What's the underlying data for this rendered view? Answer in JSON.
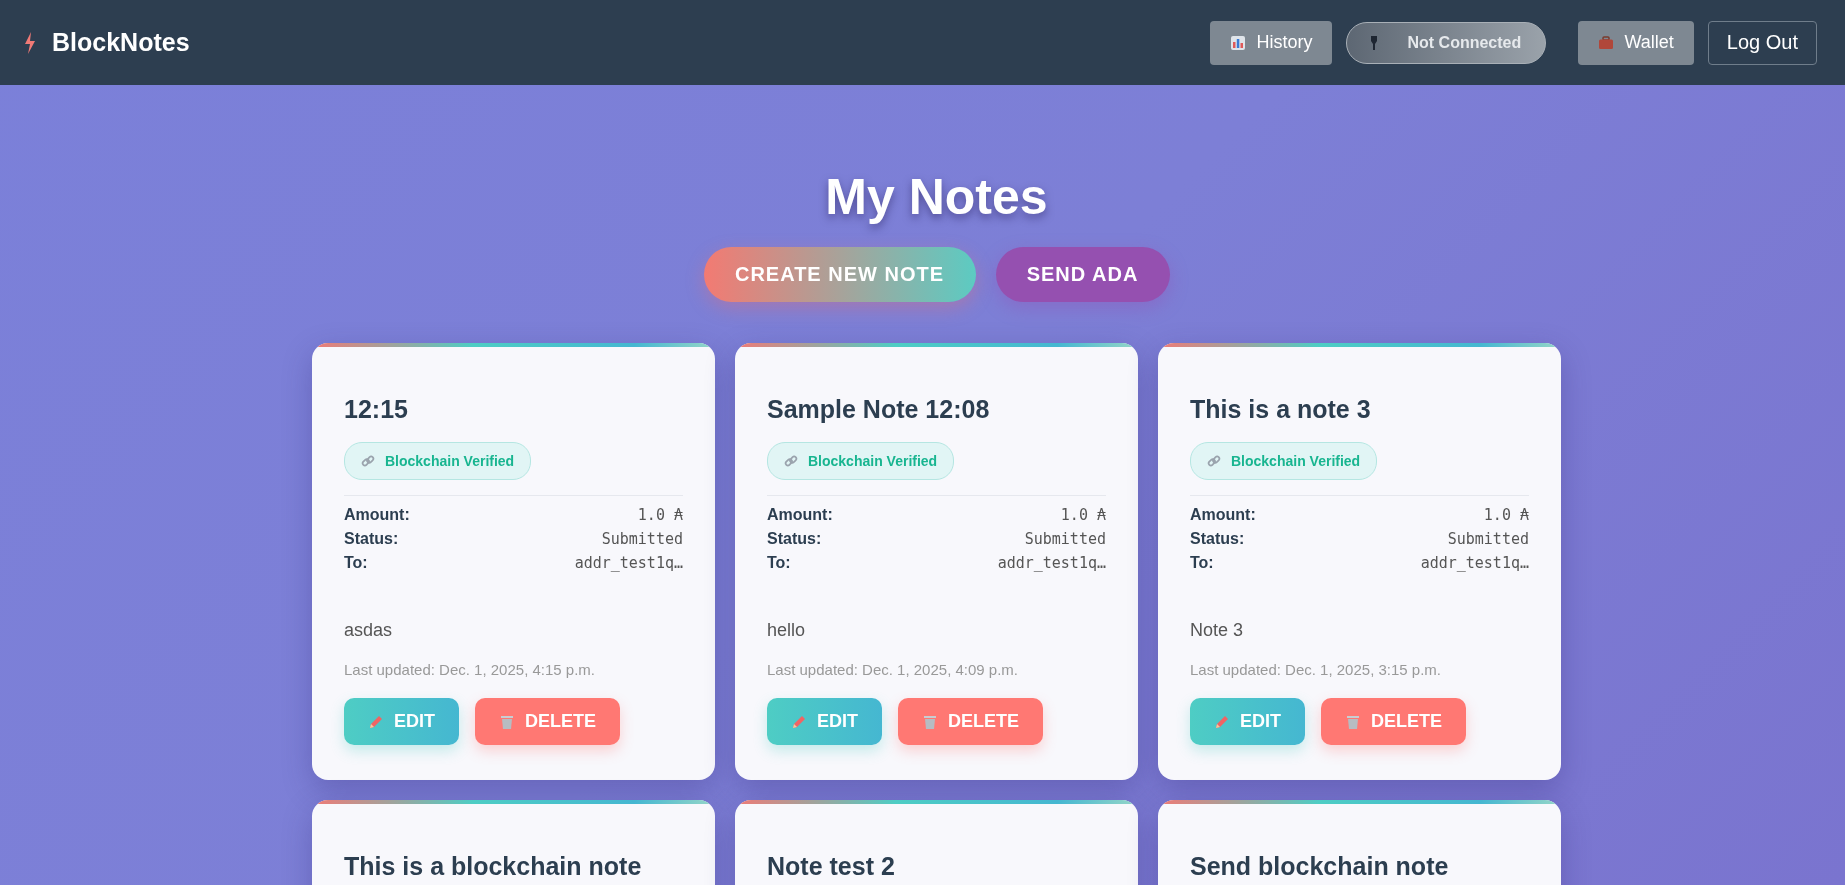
{
  "brand": "BlockNotes",
  "nav": [
    {
      "kind": "history",
      "label": "History"
    },
    {
      "kind": "status",
      "label": "Not Connected"
    },
    {
      "kind": "wallet",
      "label": "Wallet"
    },
    {
      "kind": "logout",
      "label": "Log Out"
    }
  ],
  "heading": "My Notes",
  "actions": [
    {
      "kind": "gradient",
      "label": "CREATE NEW NOTE"
    },
    {
      "kind": "purple",
      "label": "SEND ADA"
    }
  ],
  "notes": [
    {
      "title": "12:15",
      "badge": "Blockchain Verified",
      "details": [
        {
          "label": "Amount:",
          "value": "1.0 ₳"
        },
        {
          "label": "Status:",
          "value": "Submitted"
        },
        {
          "label": "To:",
          "value": "addr_test1q…"
        }
      ],
      "body": "asdas",
      "updated": "Last updated: Dec. 1, 2025, 4:15 p.m.",
      "buttons": [
        {
          "kind": "edit",
          "label": "EDIT"
        },
        {
          "kind": "delete",
          "label": "DELETE"
        }
      ]
    },
    {
      "title": "Sample Note 12:08",
      "badge": "Blockchain Verified",
      "details": [
        {
          "label": "Amount:",
          "value": "1.0 ₳"
        },
        {
          "label": "Status:",
          "value": "Submitted"
        },
        {
          "label": "To:",
          "value": "addr_test1q…"
        }
      ],
      "body": "hello",
      "updated": "Last updated: Dec. 1, 2025, 4:09 p.m.",
      "buttons": [
        {
          "kind": "edit",
          "label": "EDIT"
        },
        {
          "kind": "delete",
          "label": "DELETE"
        }
      ]
    },
    {
      "title": "This is a note 3",
      "badge": "Blockchain Verified",
      "details": [
        {
          "label": "Amount:",
          "value": "1.0 ₳"
        },
        {
          "label": "Status:",
          "value": "Submitted"
        },
        {
          "label": "To:",
          "value": "addr_test1q…"
        }
      ],
      "body": "Note 3",
      "updated": "Last updated: Dec. 1, 2025, 3:15 p.m.",
      "buttons": [
        {
          "kind": "edit",
          "label": "EDIT"
        },
        {
          "kind": "delete",
          "label": "DELETE"
        }
      ]
    },
    {
      "title": "This is a blockchain note"
    },
    {
      "title": "Note test 2"
    },
    {
      "title": "Send blockchain note"
    }
  ]
}
